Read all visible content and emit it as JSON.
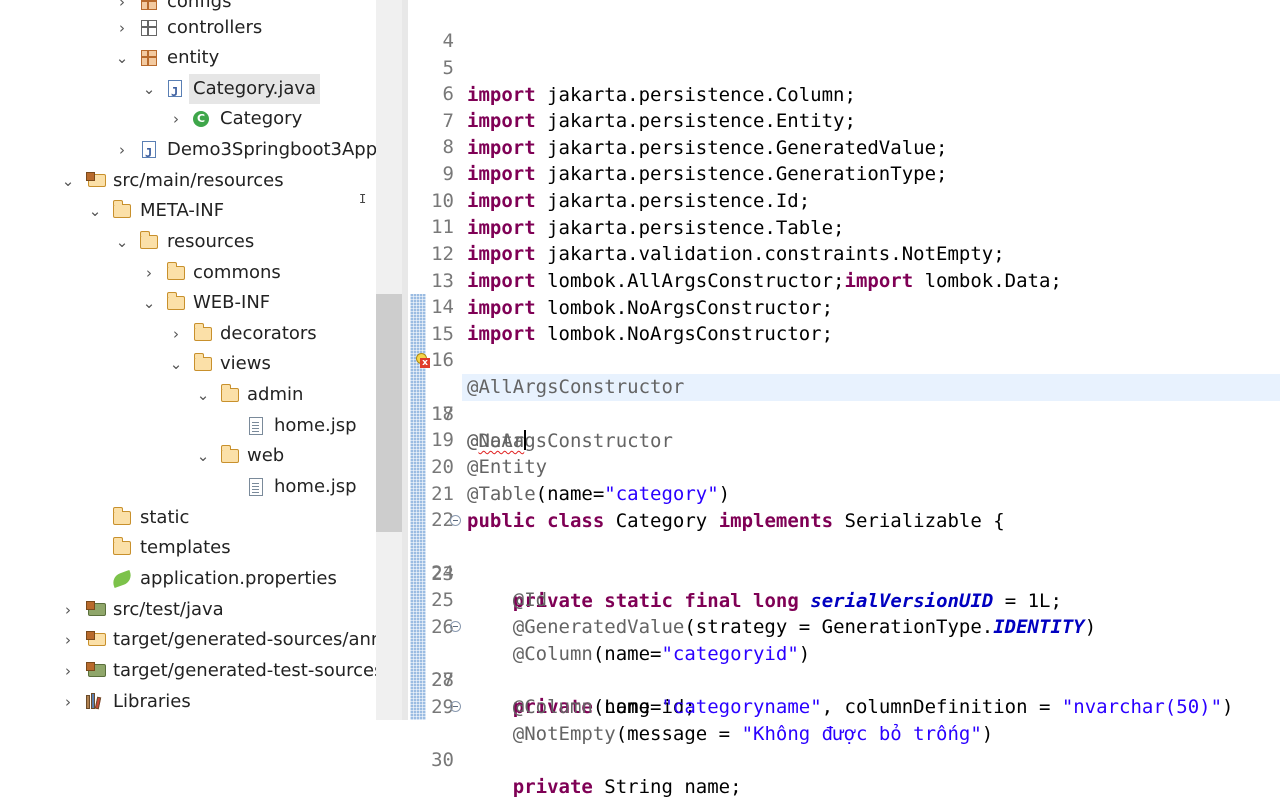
{
  "explorer": {
    "items": [
      {
        "label": "configs",
        "icon": "package-icon"
      },
      {
        "label": "controllers",
        "icon": "package-icon"
      },
      {
        "label": "entity",
        "icon": "package-icon"
      },
      {
        "label": "Category.java",
        "icon": "java-file-icon"
      },
      {
        "label": "Category",
        "icon": "class-icon"
      },
      {
        "label": "Demo3Springboot3App",
        "icon": "java-file-icon"
      },
      {
        "label": "src/main/resources",
        "icon": "source-folder-icon"
      },
      {
        "label": "META-INF",
        "icon": "folder-icon"
      },
      {
        "label": "resources",
        "icon": "folder-icon"
      },
      {
        "label": "commons",
        "icon": "folder-icon"
      },
      {
        "label": "WEB-INF",
        "icon": "folder-icon"
      },
      {
        "label": "decorators",
        "icon": "folder-icon"
      },
      {
        "label": "views",
        "icon": "folder-icon"
      },
      {
        "label": "admin",
        "icon": "folder-icon"
      },
      {
        "label": "home.jsp",
        "icon": "file-icon"
      },
      {
        "label": "web",
        "icon": "folder-icon"
      },
      {
        "label": "home.jsp",
        "icon": "file-icon"
      },
      {
        "label": "static",
        "icon": "folder-icon"
      },
      {
        "label": "templates",
        "icon": "folder-icon"
      },
      {
        "label": "application.properties",
        "icon": "spring-properties-icon"
      },
      {
        "label": "src/test/java",
        "icon": "source-folder-icon"
      },
      {
        "label": "target/generated-sources/annotations",
        "icon": "source-folder-icon"
      },
      {
        "label": "target/generated-test-sources/test-annotations",
        "icon": "source-folder-icon"
      },
      {
        "label": "Libraries",
        "icon": "libraries-icon"
      }
    ]
  },
  "editor": {
    "error_marker": "lightbulb-error-icon",
    "lines": [
      {
        "n": "4",
        "t": ""
      },
      {
        "n": "5",
        "t": "import jakarta.persistence.Column;"
      },
      {
        "n": "6",
        "t": "import jakarta.persistence.Entity;"
      },
      {
        "n": "7",
        "t": "import jakarta.persistence.GeneratedValue;"
      },
      {
        "n": "8",
        "t": "import jakarta.persistence.GenerationType;"
      },
      {
        "n": "9",
        "t": "import jakarta.persistence.Id;"
      },
      {
        "n": "10",
        "t": "import jakarta.persistence.Table;"
      },
      {
        "n": "11",
        "t": "import jakarta.validation.constraints.NotEmpty;"
      },
      {
        "n": "12",
        "t": "import lombok.AllArgsConstructor;import lombok.Data;"
      },
      {
        "n": "13",
        "t": "import lombok.NoArgsConstructor;"
      },
      {
        "n": "14",
        "t": "import lombok.NoArgsConstructor;"
      },
      {
        "n": "15",
        "t": ""
      },
      {
        "n": "16",
        "t": "@AllArgsConstructor"
      },
      {
        "n": "17",
        "t": "@NoArgsConstructor"
      },
      {
        "n": "18",
        "t": "@Data"
      },
      {
        "n": "19",
        "t": "@Entity"
      },
      {
        "n": "20",
        "t": "@Table(name=\"category\")"
      },
      {
        "n": "21",
        "t": "public class Category implements Serializable {"
      },
      {
        "n": "22",
        "t": ""
      },
      {
        "n": "23",
        "t": "    private static final long serialVersionUID = 1L;"
      },
      {
        "n": "24",
        "t": "    @Id"
      },
      {
        "n": "25",
        "t": "    @GeneratedValue(strategy = GenerationType.IDENTITY)"
      },
      {
        "n": "26",
        "t": "    @Column(name=\"categoryid\")"
      },
      {
        "n": "27",
        "t": "    private Long id;"
      },
      {
        "n": "28",
        "t": "    @Column(name=\"categoryname\", columnDefinition = \"nvarchar(50)\")"
      },
      {
        "n": "29",
        "t": "    @NotEmpty(message = \"Không được bỏ trống\")"
      },
      {
        "n": "30",
        "t": "    private String name;"
      }
    ]
  }
}
